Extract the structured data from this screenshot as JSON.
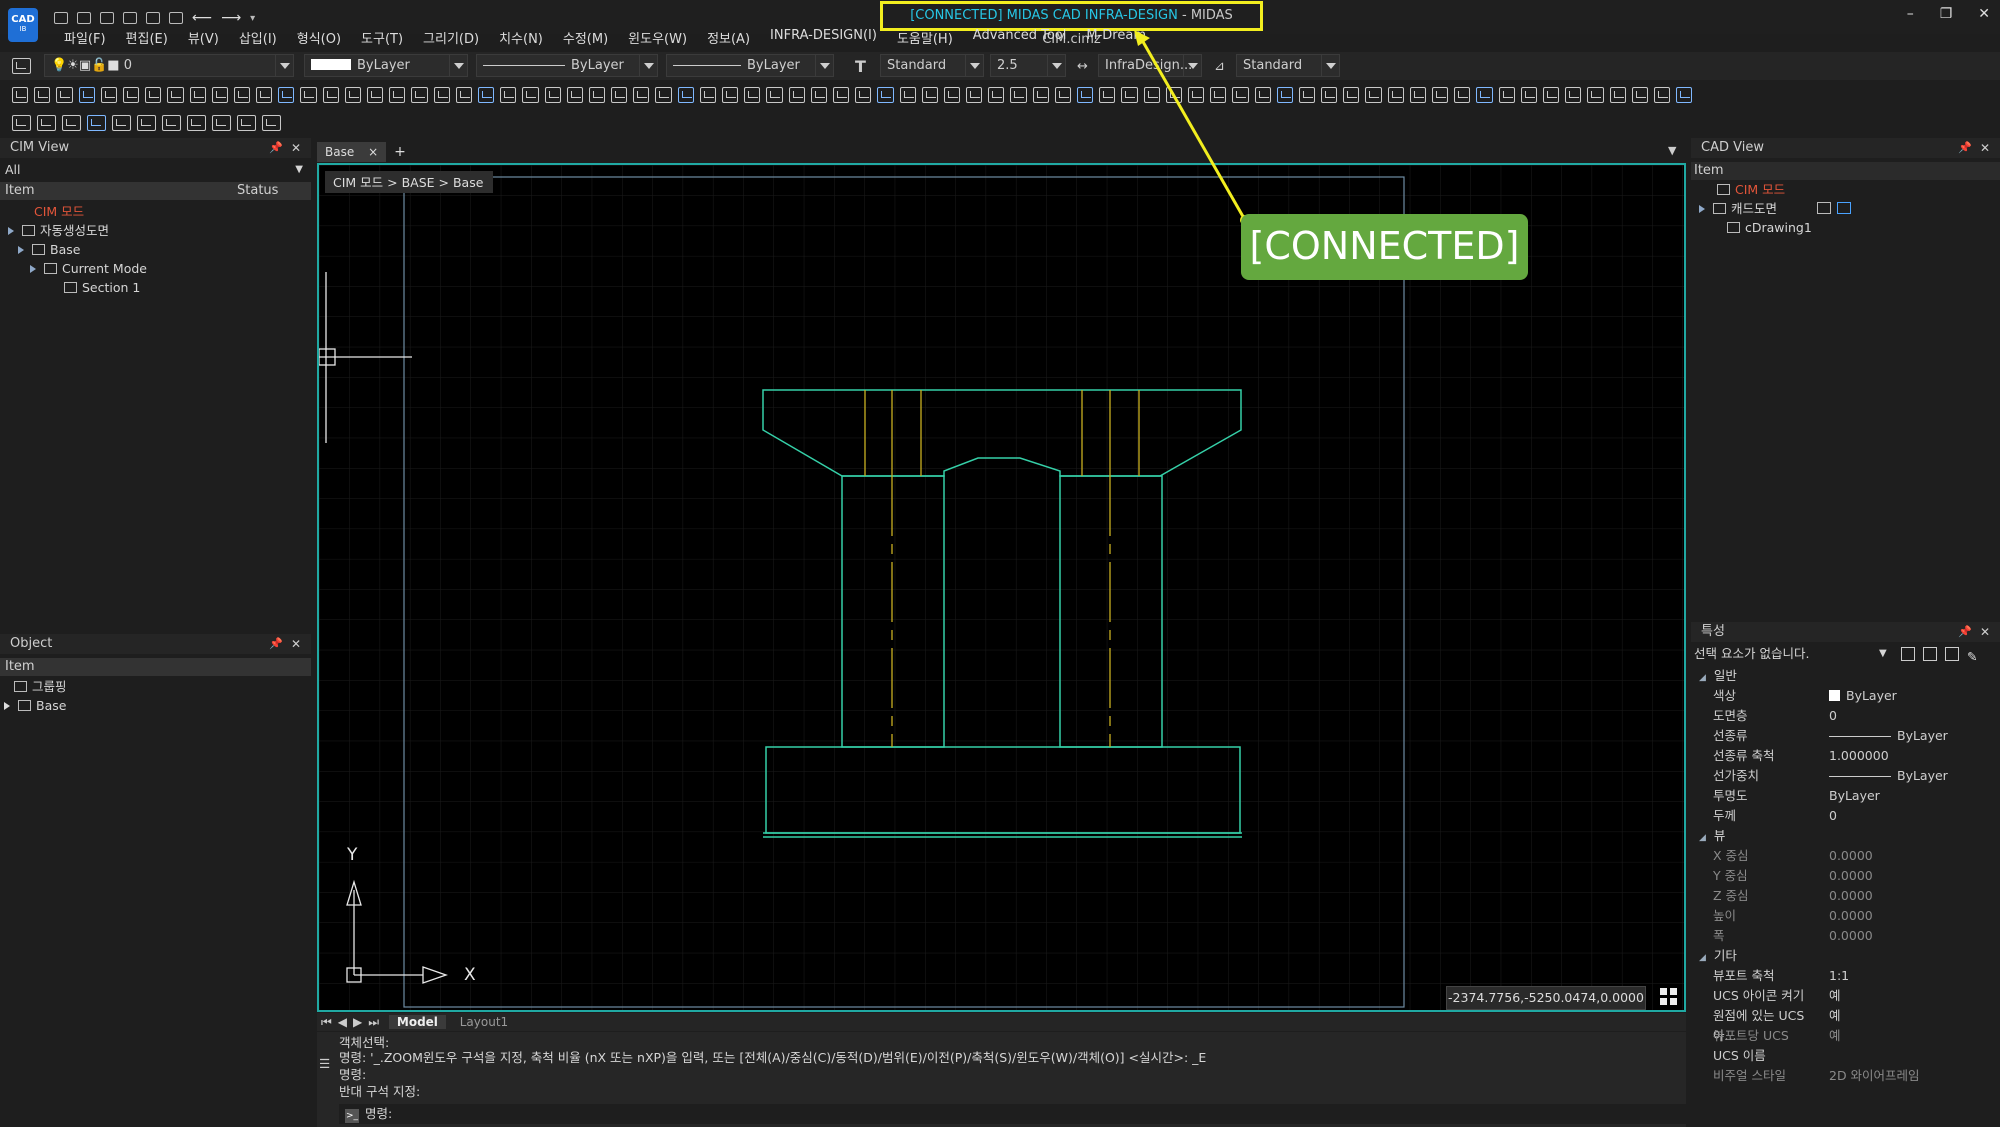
{
  "app": {
    "logo_text": "CAD",
    "logo_sub": "IB"
  },
  "title": {
    "connected_prefix": "[CONNECTED] MIDAS CAD INFRA-DESIGN",
    "suffix": "- MIDAS CIM.cimz"
  },
  "window_controls": [
    "–",
    "❐",
    "✕"
  ],
  "menu": [
    "파일(F)",
    "편집(E)",
    "뷰(V)",
    "삽입(I)",
    "형식(O)",
    "도구(T)",
    "그리기(D)",
    "치수(N)",
    "수정(M)",
    "윈도우(W)",
    "정보(A)",
    "INFRA-DESIGN(I)",
    "도움말(H)",
    "Advanced Tool",
    "M-Dream"
  ],
  "toolbar": {
    "layer_value": "0",
    "color_value": "ByLayer",
    "linetype_value": "ByLayer",
    "lineweight_value": "ByLayer",
    "text_style": "Standard",
    "text_height": "2.5",
    "dim_style": "InfraDesign...",
    "table_style": "Standard"
  },
  "cim_view": {
    "title": "CIM View",
    "filter": "All",
    "col_item": "Item",
    "col_status": "Status",
    "items": [
      "CIM 모드",
      "자동생성도면",
      "Base",
      "Current Mode",
      "Section 1"
    ]
  },
  "object_panel": {
    "title": "Object",
    "col_item": "Item",
    "items": [
      "그룹핑",
      "Base"
    ]
  },
  "tabs": {
    "active": "Base",
    "close": "×",
    "add": "+"
  },
  "breadcrumb": "CIM 모드 > BASE > Base",
  "axis": {
    "x": "X",
    "y": "Y"
  },
  "coords": "-2374.7756,-5250.0474,0.0000",
  "layout_tabs": {
    "model": "Model",
    "layout1": "Layout1"
  },
  "command_lines": [
    "객체선택:",
    "명령: '_.ZOOM윈도우 구석을 지정, 축척 비율 (nX 또는 nXP)을 입력, 또는 [전체(A)/중심(C)/동적(D)/범위(E)/이전(P)/축척(S)/윈도우(W)/객체(O)] <실시간>: _E",
    "명령:",
    "반대 구석 지정:"
  ],
  "command_prompt": "명령:",
  "cad_view": {
    "title": "CAD View",
    "col_item": "Item",
    "items": [
      "CIM 모드",
      "캐드도면",
      "cDrawing1"
    ]
  },
  "properties": {
    "title": "특성",
    "selection": "선택 요소가 없습니다.",
    "sections": [
      {
        "name": "일반",
        "rows": [
          {
            "k": "색상",
            "v": "ByLayer"
          },
          {
            "k": "도면층",
            "v": "0"
          },
          {
            "k": "선종류",
            "v": "ByLayer"
          },
          {
            "k": "선종류 축척",
            "v": "1.000000"
          },
          {
            "k": "선가중치",
            "v": "ByLayer"
          },
          {
            "k": "투명도",
            "v": "ByLayer"
          },
          {
            "k": "두께",
            "v": "0"
          }
        ]
      },
      {
        "name": "뷰",
        "rows": [
          {
            "k": "X 중심",
            "v": "0.0000"
          },
          {
            "k": "Y 중심",
            "v": "0.0000"
          },
          {
            "k": "Z 중심",
            "v": "0.0000"
          },
          {
            "k": "높이",
            "v": "0.0000"
          },
          {
            "k": "폭",
            "v": "0.0000"
          }
        ]
      },
      {
        "name": "기타",
        "rows": [
          {
            "k": "뷰포트 축척",
            "v": "1:1"
          },
          {
            "k": "UCS 아이콘 켜기",
            "v": "예"
          },
          {
            "k": "원점에 있는 UCS 아...",
            "v": "예"
          },
          {
            "k": "뷰포트당 UCS",
            "v": "예"
          },
          {
            "k": "UCS 이름",
            "v": ""
          },
          {
            "k": "비주얼 스타일",
            "v": "2D 와이어프레임"
          }
        ]
      }
    ]
  },
  "callout": "[CONNECTED]",
  "colors": {
    "accent": "#f2ee1f",
    "canvas_border": "#20a9a3",
    "drawing": "#35d0a8",
    "hidden": "#c9b021",
    "callout": "#64a83f"
  }
}
